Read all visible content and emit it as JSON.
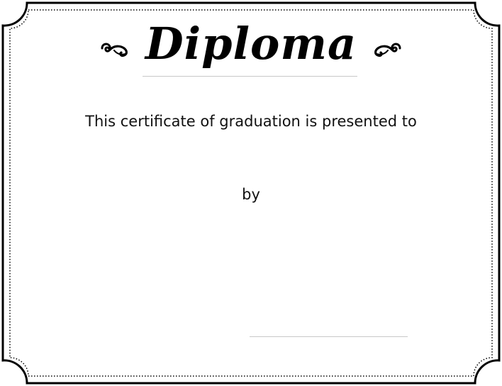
{
  "certificate": {
    "title": "Diploma",
    "presented_text": "This certificate of graduation is presented to",
    "by_text": "by"
  },
  "colors": {
    "background": "#ffffff",
    "ink": "#111111",
    "border": "#000000",
    "rule": "#c8c8c8"
  },
  "icons": {
    "left_ornament": "flourish-icon",
    "right_ornament": "flourish-icon"
  }
}
